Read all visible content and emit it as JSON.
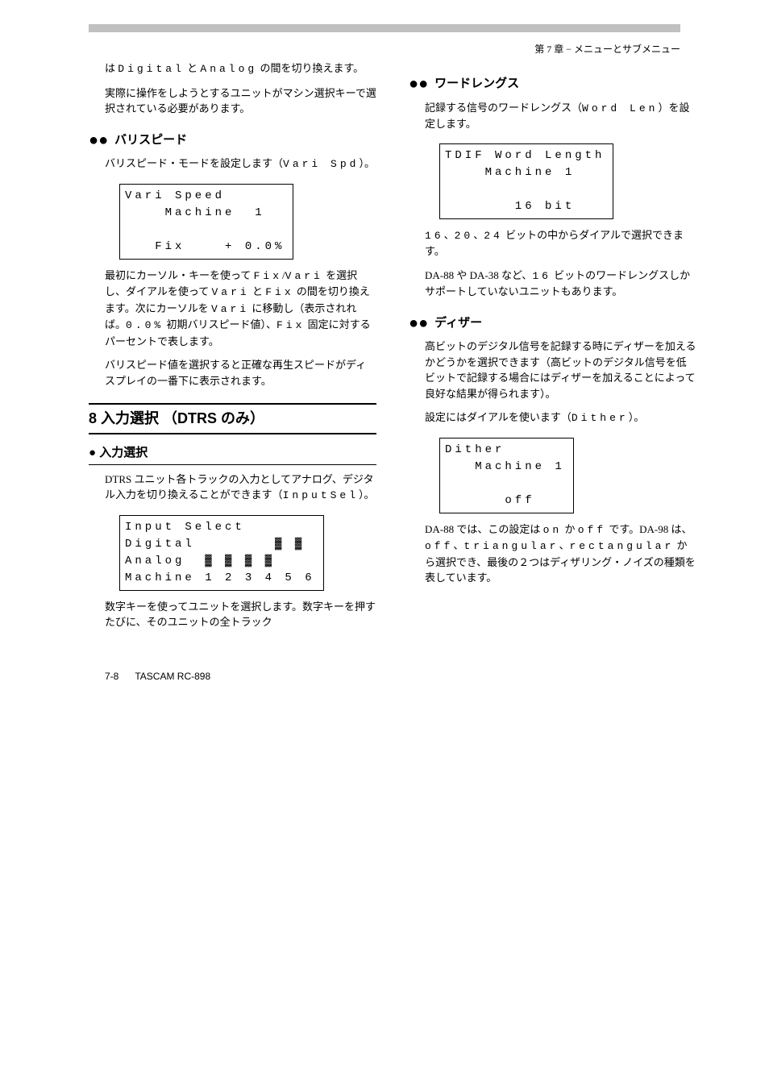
{
  "header": {
    "left": "",
    "right": "第 7 章 − メニューとサブメニュー"
  },
  "left_col": {
    "p1_pre": "は ",
    "p1_code1": "Digital",
    "p1_mid": " と ",
    "p1_code2": "Analog",
    "p1_post": " の間を切り換えます。",
    "p2": "実際に操作をしようとするユニットがマシン選択キーで選択されている必要があります。",
    "vari_title": "バリスピード",
    "vari_body_a": "バリスピード・モードを設定します（",
    "vari_code1": "Vari Spd",
    "vari_body_b": "）。",
    "vari_lcd": "Vari Speed\n    Machine  1\n\n   Fix    + 0.0%",
    "vari_body2_a": "最初にカーソル・キーを使って ",
    "vari_code2": "Fix",
    "vari_body2_b": "/",
    "vari_code3": "Vari",
    "vari_body2_c": " を選択し、ダイアルを使って ",
    "vari_code4": "Vari",
    "vari_body2_d": " と ",
    "vari_code5": "Fix",
    "vari_body2_e": " の間を切り換えます。次にカーソルを ",
    "vari_code6": "Vari",
    "vari_body2_f": " に移動し（表示されれば。",
    "vari_code7": "0.0%",
    "vari_body2_g": " 初期バリスピード値）、",
    "vari_code8": "Fix",
    "vari_body2_h": " 固定に対するパーセントで表します。",
    "vari_body3": "バリスピード値を選択すると正確な再生スピードがディスプレイの一番下に表示されます。",
    "section": "8 入力選択 （DTRS のみ）",
    "subsection": "● 入力選択",
    "inputsel_body_a": "DTRS ユニット各トラックの入力としてアナログ、デジタル入力を切り換えることができます（",
    "inputsel_code": "InputSel",
    "inputsel_body_b": "）。",
    "inputsel_lcd": "Input Select\nDigital        ▓ ▓\nAnalog  ▓ ▓ ▓ ▓\nMachine 1 2 3 4 5 6",
    "inputsel_p2": "数字キーを使ってユニットを選択します。数字キーを押すたびに、そのユニットの全トラック"
  },
  "right_col": {
    "wordlen_title": "ワードレングス",
    "wordlen_body_a": "記録する信号のワードレングス（",
    "wordlen_code": "Word Len",
    "wordlen_body_b": "）を設定します。",
    "wordlen_lcd": "TDIF Word Length\n    Machine 1\n\n       16 bit",
    "wordlen_opts_a": "",
    "wordlen_opts_code1": "16",
    "wordlen_opts_mid1": "、",
    "wordlen_opts_code2": "20",
    "wordlen_opts_mid2": "、",
    "wordlen_opts_code3": "24",
    "wordlen_opts_b": " ビットの中からダイアルで選択できます。",
    "wordlen_p2_a": "DA-88 や DA-38 など、",
    "wordlen_p2_code": "16",
    "wordlen_p2_b": " ビットのワードレングスしかサポートしていないユニットもあります。",
    "dither_title": "ディザー",
    "dither_body_a": "高ビットのデジタル信号を記録する時にディザーを加えるかどうかを選択できます（高ビットのデジタル信号を低ビットで記録する場合にはディザーを加えることによって良好な結果が得られます）。",
    "dither_body_b": "設定にはダイアルを使います（",
    "dither_code": "Dither",
    "dither_body_c": "）。",
    "dither_lcd": "Dither\n   Machine 1\n\n      off",
    "dither_p2_a": "DA-88 では、この設定は ",
    "dither_on": "on",
    "dither_p2_b": " か ",
    "dither_off": "off",
    "dither_p2_c": " です。DA-98 は、",
    "dither_off2": "off",
    "dither_p2_d": "、",
    "dither_tri": "triangular",
    "dither_p2_e": "、",
    "dither_rect": "rectangular",
    "dither_p2_f": " から選択でき、最後の２つはディザリング・ノイズの種類を表しています。"
  },
  "footer": {
    "page": "7-8",
    "title": "TASCAM RC-898"
  }
}
